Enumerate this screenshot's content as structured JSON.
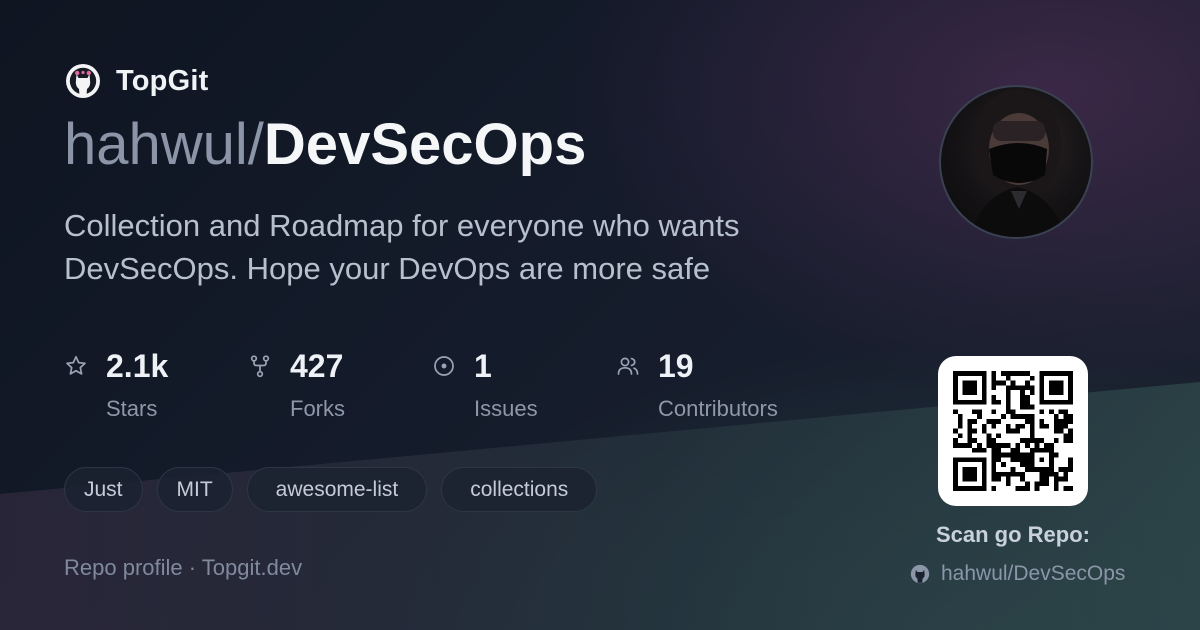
{
  "brand": {
    "name": "TopGit",
    "icon": "github-octocat-icon"
  },
  "repo": {
    "owner": "hahwul/",
    "name": "DevSecOps"
  },
  "description": "Collection and Roadmap for everyone who wants DevSecOps. Hope your DevOps are more safe",
  "stats": [
    {
      "icon": "star-icon",
      "value": "2.1k",
      "label": "Stars"
    },
    {
      "icon": "fork-icon",
      "value": "427",
      "label": "Forks"
    },
    {
      "icon": "issue-icon",
      "value": "1",
      "label": "Issues"
    },
    {
      "icon": "people-icon",
      "value": "19",
      "label": "Contributors"
    }
  ],
  "tags": [
    "Just",
    "MIT",
    "awesome-list",
    "collections"
  ],
  "footer": {
    "text": "Repo profile · Topgit.dev"
  },
  "qr": {
    "label": "Scan go Repo:",
    "repo_link": "hahwul/DevSecOps"
  },
  "colors": {
    "background": "#141b2a",
    "accent_text": "#f4f6f8",
    "muted_text": "#8b95a7"
  }
}
